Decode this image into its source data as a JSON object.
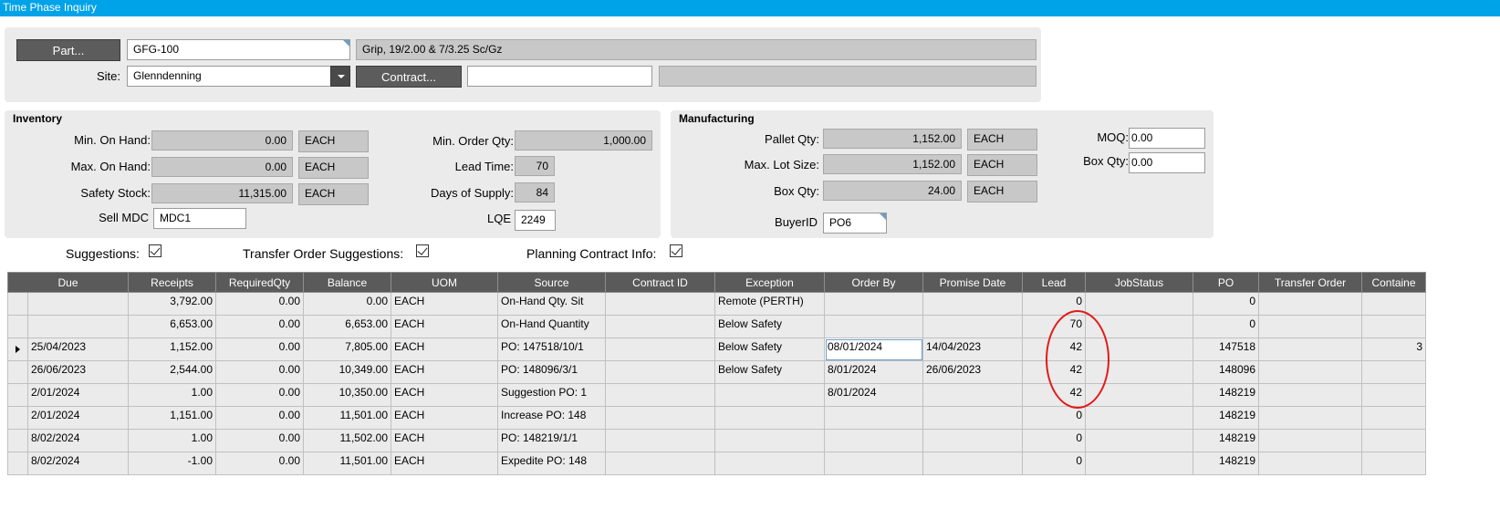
{
  "window": {
    "title": "Time Phase Inquiry"
  },
  "header": {
    "part_button": "Part...",
    "part_value": "GFG-100",
    "part_description": "Grip, 19/2.00 & 7/3.25 Sc/Gz",
    "site_label": "Site:",
    "site_value": "Glenndenning",
    "contract_button": "Contract...",
    "contract_value": "",
    "contract_description": ""
  },
  "inventory": {
    "title": "Inventory",
    "min_on_hand_label": "Min. On Hand:",
    "min_on_hand": "0.00",
    "min_on_hand_uom": "EACH",
    "max_on_hand_label": "Max. On Hand:",
    "max_on_hand": "0.00",
    "max_on_hand_uom": "EACH",
    "safety_stock_label": "Safety Stock:",
    "safety_stock": "11,315.00",
    "safety_stock_uom": "EACH",
    "sell_mdc_label": "Sell MDC",
    "sell_mdc": "MDC1",
    "min_order_qty_label": "Min. Order Qty:",
    "min_order_qty": "1,000.00",
    "lead_time_label": "Lead Time:",
    "lead_time": "70",
    "days_of_supply_label": "Days of Supply:",
    "days_of_supply": "84",
    "lqe_label": "LQE",
    "lqe": "2249"
  },
  "manufacturing": {
    "title": "Manufacturing",
    "pallet_qty_label": "Pallet Qty:",
    "pallet_qty": "1,152.00",
    "pallet_qty_uom": "EACH",
    "max_lot_size_label": "Max. Lot Size:",
    "max_lot_size": "1,152.00",
    "max_lot_size_uom": "EACH",
    "box_qty_label": "Box Qty:",
    "box_qty": "24.00",
    "box_qty_uom": "EACH",
    "buyer_id_label": "BuyerID",
    "buyer_id": "PO6",
    "moq_label": "MOQ:",
    "moq": "0.00",
    "box_qty2_label": "Box Qty:",
    "box_qty2": "0.00"
  },
  "options": {
    "suggestions": "Suggestions:",
    "transfer_order_suggestions": "Transfer Order Suggestions:",
    "planning_contract_info": "Planning Contract Info:"
  },
  "grid": {
    "columns": [
      "Due",
      "Receipts",
      "RequiredQty",
      "Balance",
      "UOM",
      "Source",
      "Contract ID",
      "Exception",
      "Order By",
      "Promise Date",
      "Lead",
      "JobStatus",
      "PO",
      "Transfer Order",
      "Containe"
    ],
    "rows": [
      {
        "due": "",
        "receipts": "3,792.00",
        "required": "0.00",
        "balance": "0.00",
        "uom": "EACH",
        "source": "On-Hand Qty. Sit",
        "contract": "",
        "exception": "Remote (PERTH)",
        "order_by": "",
        "promise": "",
        "lead": "0",
        "job_status": "",
        "po": "0",
        "transfer": "",
        "container": ""
      },
      {
        "due": "",
        "receipts": "6,653.00",
        "required": "0.00",
        "balance": "6,653.00",
        "uom": "EACH",
        "source": "On-Hand Quantity",
        "contract": "",
        "exception": "Below Safety",
        "order_by": "",
        "promise": "",
        "lead": "70",
        "job_status": "",
        "po": "0",
        "transfer": "",
        "container": ""
      },
      {
        "due": "25/04/2023",
        "receipts": "1,152.00",
        "required": "0.00",
        "balance": "7,805.00",
        "uom": "EACH",
        "source": "PO: 147518/10/1",
        "contract": "",
        "exception": "Below Safety",
        "order_by": "08/01/2024",
        "promise": "14/04/2023",
        "lead": "42",
        "job_status": "",
        "po": "147518",
        "transfer": "",
        "container": "3"
      },
      {
        "due": "26/06/2023",
        "receipts": "2,544.00",
        "required": "0.00",
        "balance": "10,349.00",
        "uom": "EACH",
        "source": "PO: 148096/3/1",
        "contract": "",
        "exception": "Below Safety",
        "order_by": "8/01/2024",
        "promise": "26/06/2023",
        "lead": "42",
        "job_status": "",
        "po": "148096",
        "transfer": "",
        "container": ""
      },
      {
        "due": "2/01/2024",
        "receipts": "1.00",
        "required": "0.00",
        "balance": "10,350.00",
        "uom": "EACH",
        "source": "Suggestion PO: 1",
        "contract": "",
        "exception": "",
        "order_by": "8/01/2024",
        "promise": "",
        "lead": "42",
        "job_status": "",
        "po": "148219",
        "transfer": "",
        "container": ""
      },
      {
        "due": "2/01/2024",
        "receipts": "1,151.00",
        "required": "0.00",
        "balance": "11,501.00",
        "uom": "EACH",
        "source": "Increase PO: 148",
        "contract": "",
        "exception": "",
        "order_by": "",
        "promise": "",
        "lead": "0",
        "job_status": "",
        "po": "148219",
        "transfer": "",
        "container": ""
      },
      {
        "due": "8/02/2024",
        "receipts": "1.00",
        "required": "0.00",
        "balance": "11,502.00",
        "uom": "EACH",
        "source": "PO: 148219/1/1",
        "contract": "",
        "exception": "",
        "order_by": "",
        "promise": "",
        "lead": "0",
        "job_status": "",
        "po": "148219",
        "transfer": "",
        "container": ""
      },
      {
        "due": "8/02/2024",
        "receipts": "-1.00",
        "required": "0.00",
        "balance": "11,501.00",
        "uom": "EACH",
        "source": "Expedite PO: 148",
        "contract": "",
        "exception": "",
        "order_by": "",
        "promise": "",
        "lead": "0",
        "job_status": "",
        "po": "148219",
        "transfer": "",
        "container": ""
      }
    ]
  }
}
